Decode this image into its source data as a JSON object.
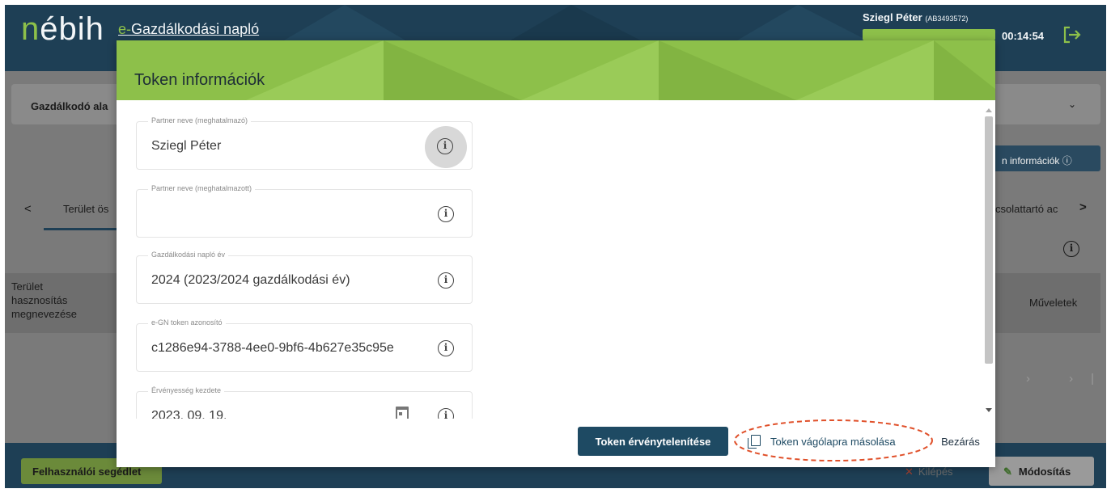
{
  "header": {
    "logo": "nébih",
    "app_title_e": "e-",
    "app_title_rest": "Gazdálkodási napló",
    "user_name": "Sziegl Péter",
    "user_id": "(AB3493572)",
    "session_timer": "00:14:54"
  },
  "background": {
    "card_label": "Gazdálkodó ala",
    "info_button": "n információk",
    "tab_left": "Terület ös",
    "tab_right": "csolattartó ac",
    "table_header_left_1": "Terület",
    "table_header_left_2": "hasznosítás",
    "table_header_left_3": "megnevezése",
    "table_header_right": "Műveletek"
  },
  "footer": {
    "help_label": "Felhasználói segédlet",
    "exit_label": "Kilépés",
    "modify_label": "Módosítás"
  },
  "modal": {
    "title": "Token információk",
    "fields": [
      {
        "label": "Partner neve (meghatalmazó)",
        "value": "Sziegl Péter"
      },
      {
        "label": "Partner neve (meghatalmazott)",
        "value": ""
      },
      {
        "label": "Gazdálkodási napló év",
        "value": "2024 (2023/2024 gazdálkodási év)"
      },
      {
        "label": "e-GN token azonosító",
        "value": "c1286e94-3788-4ee0-9bf6-4b627e35c95e"
      },
      {
        "label": "Érvényesség kezdete",
        "value": "2023. 09. 19."
      }
    ],
    "buttons": {
      "invalidate": "Token érvénytelenítése",
      "copy": "Token vágólapra másolása",
      "close": "Bezárás"
    }
  },
  "colors": {
    "brand_dark": "#1e3f55",
    "brand_green": "#8dc04a",
    "highlight_red": "#e0502a"
  }
}
